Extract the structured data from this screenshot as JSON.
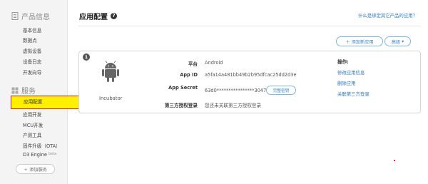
{
  "sidebar": {
    "sections": [
      {
        "title": "产品信息",
        "icon": "document-icon",
        "items": [
          "基本信息",
          "数据点",
          "虚拟设备",
          "设备日志",
          "开发向导"
        ]
      },
      {
        "title": "服务",
        "icon": "service-icon",
        "items": [
          "应用配置",
          "应用开发",
          "MCU开发",
          "产测工具",
          "固件升级（OTA）",
          "D3 Engine"
        ]
      }
    ],
    "active_item": "应用配置",
    "beta_label": "beta",
    "add_service": "＋ 添加服务"
  },
  "header": {
    "title": "应用配置",
    "help_icon": "?",
    "help_link": "什么是绑定其它产品的应用？"
  },
  "toolbar": {
    "add_app": "＋ 添加新应用",
    "advanced": "高级",
    "advanced_caret": "▾"
  },
  "app": {
    "index": "1",
    "name": "Incubator",
    "icon": "android-icon",
    "fields": {
      "platform_label": "平台",
      "platform_value": "Android",
      "appid_label": "App ID",
      "appid_value": "a5fa14a481bb49b2b95dfcac25dd2d3e",
      "secret_label": "App Secret",
      "secret_value": "63d0****************3047",
      "secret_button": "完整密钥",
      "third_party_label": "第三方授权登录",
      "third_party_value": "您还未关联第三方授权登录"
    },
    "operations": {
      "title": "操作:",
      "links": [
        "修改应用信息",
        "删除应用",
        "关联第三方登录"
      ]
    }
  },
  "colors": {
    "link": "#2b7bc8",
    "highlight": "#ffef00",
    "highlight_border": "#d9262f",
    "android_icon": "#666666"
  }
}
